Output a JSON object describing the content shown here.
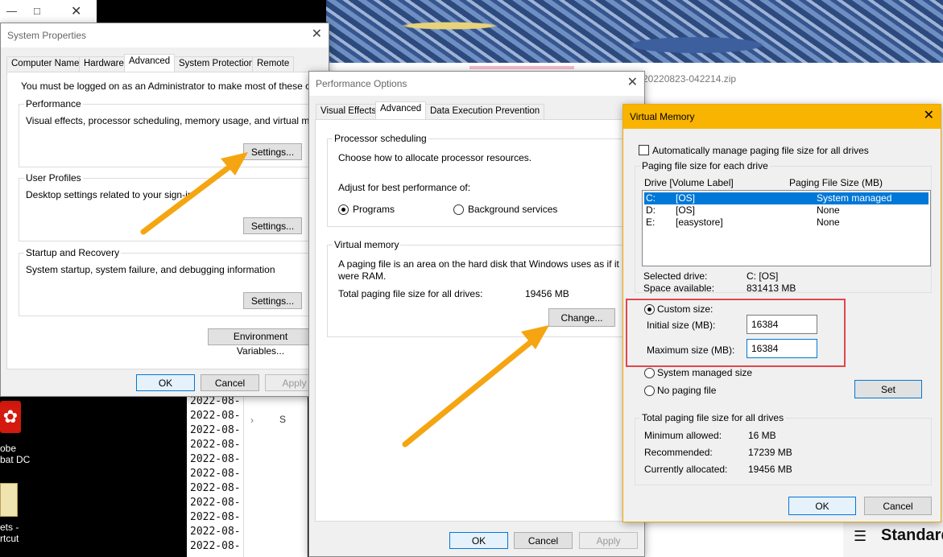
{
  "background": {
    "zip_filename": "20220823-042214.zip",
    "console_lines": [
      "2022-08-",
      "2022-08-",
      "2022-08-",
      "2022-08-",
      "2022-08-",
      "2022-08-",
      "2022-08-",
      "2022-08-",
      "2022-08-",
      "2022-08-",
      "2022-08-"
    ],
    "tree_label": "S",
    "calculator_title": "Standard",
    "desktop": {
      "acrobat_label": [
        "obe",
        "bat DC"
      ],
      "shortcut_label": [
        "ets -",
        "rtcut"
      ]
    }
  },
  "system_properties": {
    "title": "System Properties",
    "tabs": [
      "Computer Name",
      "Hardware",
      "Advanced",
      "System Protection",
      "Remote"
    ],
    "active_tab": "Advanced",
    "admin_note": "You must be logged on as an Administrator to make most of these changes.",
    "performance": {
      "label": "Performance",
      "desc": "Visual effects, processor scheduling, memory usage, and virtual memory",
      "button": "Settings..."
    },
    "user_profiles": {
      "label": "User Profiles",
      "desc": "Desktop settings related to your sign-in",
      "button": "Settings..."
    },
    "startup": {
      "label": "Startup and Recovery",
      "desc": "System startup, system failure, and debugging information",
      "button": "Settings..."
    },
    "env_button": "Environment Variables...",
    "ok": "OK",
    "cancel": "Cancel",
    "apply": "Apply"
  },
  "performance_options": {
    "title": "Performance Options",
    "tabs": [
      "Visual Effects",
      "Advanced",
      "Data Execution Prevention"
    ],
    "active_tab": "Advanced",
    "processor": {
      "label": "Processor scheduling",
      "desc": "Choose how to allocate processor resources.",
      "adjust": "Adjust for best performance of:",
      "programs": "Programs",
      "background": "Background services",
      "selected": "Programs"
    },
    "virtual_memory": {
      "label": "Virtual memory",
      "desc_line1": "A paging file is an area on the hard disk that Windows uses as if it",
      "desc_line2": "were RAM.",
      "total_label": "Total paging file size for all drives:",
      "total_value": "19456 MB",
      "change_button": "Change..."
    },
    "ok": "OK",
    "cancel": "Cancel",
    "apply": "Apply"
  },
  "virtual_memory": {
    "title": "Virtual Memory",
    "auto_manage": "Automatically manage paging file size for all drives",
    "auto_manage_checked": false,
    "each_drive_label": "Paging file size for each drive",
    "col_drive": "Drive  [Volume Label]",
    "col_size": "Paging File Size (MB)",
    "drives": [
      {
        "letter": "C:",
        "label": "[OS]",
        "size": "System managed",
        "selected": true
      },
      {
        "letter": "D:",
        "label": "[OS]",
        "size": "None",
        "selected": false
      },
      {
        "letter": "E:",
        "label": "[easystore]",
        "size": "None",
        "selected": false
      }
    ],
    "selected_drive_label": "Selected drive:",
    "selected_drive_value": "C:  [OS]",
    "space_label": "Space available:",
    "space_value": "831413 MB",
    "custom_size": "Custom size:",
    "initial_label": "Initial size (MB):",
    "initial_value": "16384",
    "maximum_label": "Maximum size (MB):",
    "maximum_value": "16384",
    "system_managed": "System managed size",
    "no_paging": "No paging file",
    "set_button": "Set",
    "selected_option": "Custom size",
    "totals_label": "Total paging file size for all drives",
    "min_label": "Minimum allowed:",
    "min_value": "16 MB",
    "rec_label": "Recommended:",
    "rec_value": "17239 MB",
    "cur_label": "Currently allocated:",
    "cur_value": "19456 MB",
    "ok": "OK",
    "cancel": "Cancel"
  },
  "colors": {
    "accent": "#0078d7",
    "arrow": "#f5a511",
    "highlight": "#e0474c",
    "vm_titlebar": "#f8b400"
  }
}
